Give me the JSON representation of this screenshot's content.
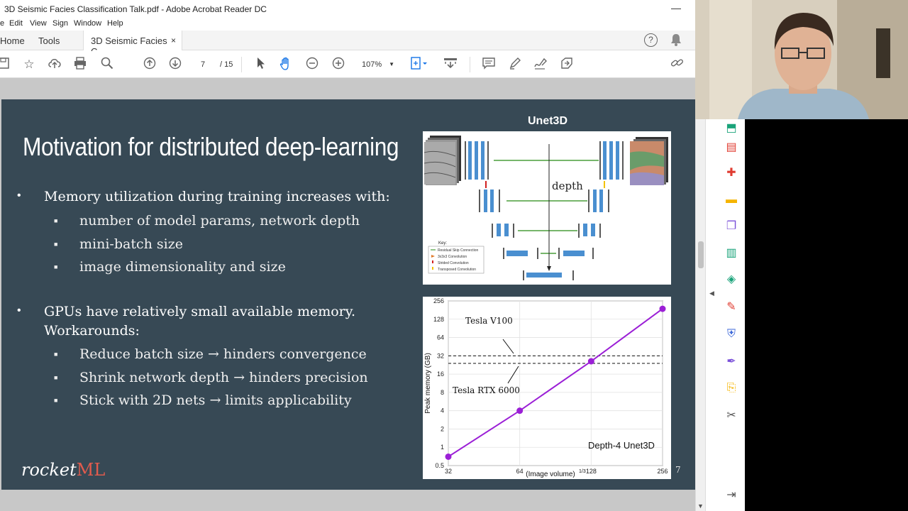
{
  "window": {
    "title": "3D Seismic Facies Classification Talk.pdf - Adobe Acrobat Reader DC",
    "minimize_glyph": "—"
  },
  "menu": [
    "e",
    "Edit",
    "View",
    "Sign",
    "Window",
    "Help"
  ],
  "tabs": {
    "home": "Home",
    "tools": "Tools",
    "doc": "3D Seismic Facies C...",
    "close": "×"
  },
  "toolbar": {
    "page_current": "7",
    "page_total": "/ 15",
    "zoom": "107%",
    "icons": [
      "save-icon",
      "bookmark-star-icon",
      "upload-icon",
      "print-icon",
      "search-zoom-icon",
      "prev-page-icon",
      "next-page-icon",
      "select-pointer-icon",
      "hand-tool-icon",
      "zoom-out-icon",
      "zoom-in-icon",
      "fit-page-icon",
      "scroll-mode-icon",
      "comment-icon",
      "highlight-pen-icon",
      "sign-icon",
      "share-icon",
      "link-icon"
    ]
  },
  "slide": {
    "title": "Motivation for distributed deep-learning",
    "bullet1": "Memory utilization during training increases with:",
    "bullet1_subs": [
      "number of model params, network depth",
      "mini-batch size",
      "image dimensionality and size"
    ],
    "bullet2_line1": "GPUs have relatively small available memory.",
    "bullet2_line2": "Workarounds:",
    "bullet2_subs": [
      "Reduce batch size → hinders convergence",
      "Shrink network depth → hinders precision",
      "Stick with 2D nets → limits applicability"
    ],
    "logo_rocket": "rocket",
    "logo_ml": "ML",
    "page_number": "7",
    "unet_title": "Unet3D",
    "unet_depth_label": "depth",
    "unet_key": {
      "title": "Key:",
      "items": [
        "Residual Skip Connection",
        "3x3x3 Convolution",
        "Strided Convolution",
        "Transposed Convolution"
      ]
    }
  },
  "chart_data": {
    "type": "line",
    "title": "",
    "xlabel": "(Image volume)",
    "xlabel_sup": "1/3",
    "ylabel": "Peak memory (GB)",
    "x_ticks": [
      "32",
      "64",
      "128",
      "256"
    ],
    "y_ticks": [
      "0.5",
      "1",
      "2",
      "4",
      "8",
      "16",
      "32",
      "64",
      "128",
      "256"
    ],
    "x_scale": "log2",
    "y_scale": "log2",
    "xlim": [
      32,
      256
    ],
    "ylim": [
      0.5,
      256
    ],
    "grid": true,
    "series": [
      {
        "name": "Depth-4 Unet3D",
        "color": "#9b1fd6",
        "x": [
          32,
          64,
          128,
          256
        ],
        "y": [
          0.7,
          4,
          26,
          190
        ]
      }
    ],
    "hlines": [
      {
        "label": "Tesla V100",
        "y": 32
      },
      {
        "label": "Tesla RTX 6000",
        "y": 24
      }
    ],
    "annotation": "Depth-4 Unet3D"
  },
  "right_panel": {
    "collapse": "◀",
    "icons": [
      {
        "name": "export-pdf-icon",
        "color": "#1aa37a"
      },
      {
        "name": "create-pdf-icon",
        "color": "#e03c31"
      },
      {
        "name": "edit-pdf-icon",
        "color": "#e03c31"
      },
      {
        "name": "comment-tool-icon",
        "color": "#f5b400"
      },
      {
        "name": "combine-files-icon",
        "color": "#7b51d9"
      },
      {
        "name": "organize-pages-icon",
        "color": "#1aa37a"
      },
      {
        "name": "scan-enhance-icon",
        "color": "#1aa37a"
      },
      {
        "name": "fill-sign-icon",
        "color": "#e03c31"
      },
      {
        "name": "protect-icon",
        "color": "#3b67d8"
      },
      {
        "name": "send-sign-icon",
        "color": "#7b51d9"
      },
      {
        "name": "send-track-icon",
        "color": "#f5b400"
      },
      {
        "name": "more-tools-icon",
        "color": "#555555"
      },
      {
        "name": "expand-panel-icon",
        "color": "#555555"
      }
    ]
  }
}
